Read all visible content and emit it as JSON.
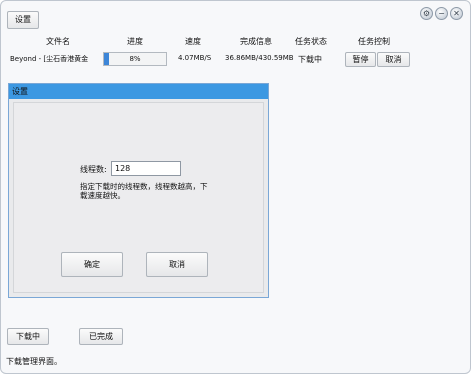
{
  "toolbar": {
    "settings_label": "设置"
  },
  "window_controls": {
    "settings_glyph": "⚙",
    "minimize_glyph": "−",
    "close_glyph": "✕"
  },
  "table": {
    "headers": {
      "file_name": "文件名",
      "progress": "进度",
      "speed": "速度",
      "completed_info": "完成信息",
      "task_status": "任务状态",
      "task_control": "任务控制"
    },
    "rows": [
      {
        "file_name": "Beyond - [尘石香港黄金",
        "progress_text": "8%",
        "progress_value": 8,
        "speed": "4.07MB/S",
        "completed_info": "36.86MB/430.59MB",
        "status": "下载中",
        "pause_label": "暂停",
        "cancel_label": "取消"
      }
    ]
  },
  "dialog": {
    "title": "设置",
    "thread_label": "线程数:",
    "thread_value": "128",
    "hint": "指定下载时的线程数，线程数越高，下载速度越快。",
    "ok_label": "确定",
    "cancel_label": "取消"
  },
  "tabs": {
    "downloading_label": "下载中",
    "completed_label": "已完成"
  },
  "status_text": "下载管理界面。",
  "colors": {
    "accent": "#3c98e2",
    "progress_fill": "#3d86d8"
  }
}
